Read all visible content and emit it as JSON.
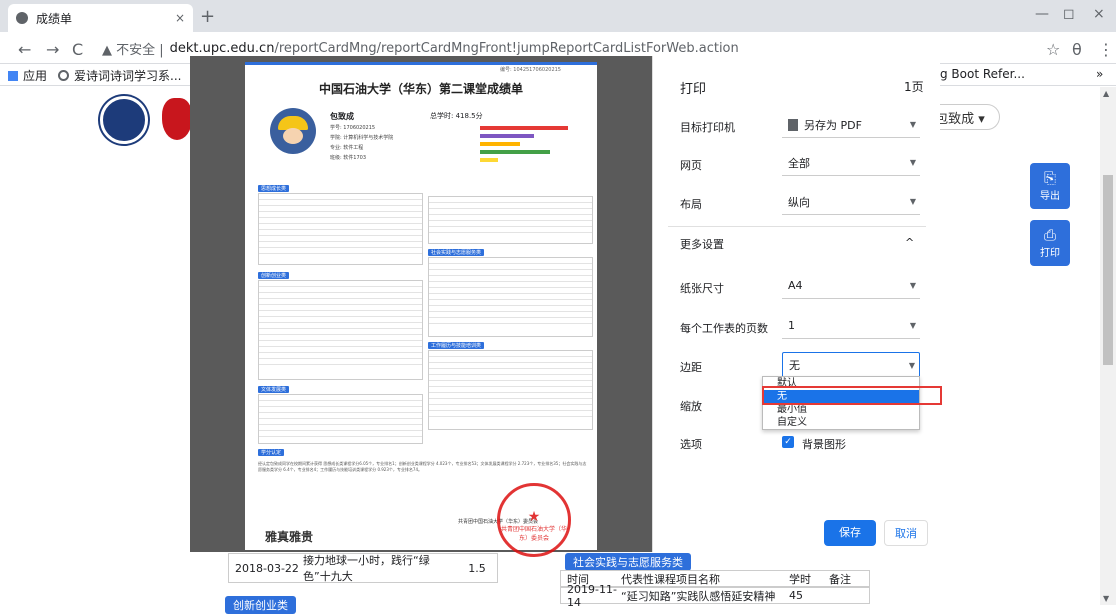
{
  "browser": {
    "tab_title": "成绩单",
    "tab_close": "×",
    "new_tab": "+",
    "win_min": "—",
    "win_max": "◻",
    "win_close": "×",
    "nav_back": "←",
    "nav_forward": "→",
    "nav_reload": "C",
    "security_label": "▲ 不安全 |",
    "url_host": "dekt.upc.edu.cn",
    "url_path": "/reportCardMng/reportCardMngFront!jumpReportCardListForWeb.action",
    "star": "☆",
    "account": "θ",
    "menu": "⋮",
    "bookmarks": {
      "apps": "应用",
      "bm1": "爱诗词诗词学习系...",
      "bm_right": "g Boot Refer...",
      "more": "»"
    }
  },
  "page": {
    "user_name": "包致成 ▾",
    "export_label": "导出",
    "print_label": "打印",
    "below_row": {
      "date": "2018-03-22",
      "name": "接力地球一小时，践行“绿色”十九大",
      "hours": "1.5"
    },
    "section_left": "创新创业类",
    "section_right": "社会实践与志愿服务类",
    "right_table": {
      "headers": [
        "时间",
        "代表性课程项目名称",
        "学时",
        "备注"
      ],
      "row": [
        "2019-11-14",
        "“延习知路”实践队感悟延安精神",
        "45",
        ""
      ]
    }
  },
  "report": {
    "title": "中国石油大学（华东）第二课堂成绩单",
    "serial": "编号: 104251706020215",
    "student_name": "包致成",
    "lines": [
      "学号: 1706020215",
      "学院: 计算机科学与技术学院",
      "专业: 软件工程",
      "班级: 软件1703"
    ],
    "total_hours": "总学时: 418.5分",
    "sections": [
      "思想成长类",
      "创新创业类",
      "文体发展类",
      "社会实践与志愿服务类",
      "工作履历与技能培训类",
      "学分认定"
    ],
    "summary": "经认定包致成同学在校期间累计获得 思想成长类课程学分6.05个，专业排名1；创新创业类课程学分 4.023个，专业排名53；文体发展类课程学分 2.723个，专业排名35；社会实践与志愿服务类学分 6.4个，专业排名4；工作履历与技能培训类课程学分 0.923个，专业排名74。",
    "signature": "雅真雅贵",
    "org": "共青团中国石油大学（华东）委员会",
    "seal_text": "共青团中国石油大学（华东）委员会"
  },
  "print_panel": {
    "title": "打印",
    "pages": "1页",
    "destination_label": "目标打印机",
    "destination_value": "另存为 PDF",
    "pages_label": "网页",
    "pages_value": "全部",
    "layout_label": "布局",
    "layout_value": "纵向",
    "more_settings": "更多设置",
    "more_icon": "^",
    "paper_label": "纸张尺寸",
    "paper_value": "A4",
    "per_sheet_label": "每个工作表的页数",
    "per_sheet_value": "1",
    "margins_label": "边距",
    "margins_value": "无",
    "margin_options": [
      "默认",
      "无",
      "最小值",
      "自定义"
    ],
    "scale_label": "缩放",
    "options_label": "选项",
    "background_label": "背景图形",
    "save": "保存",
    "cancel": "取消"
  }
}
